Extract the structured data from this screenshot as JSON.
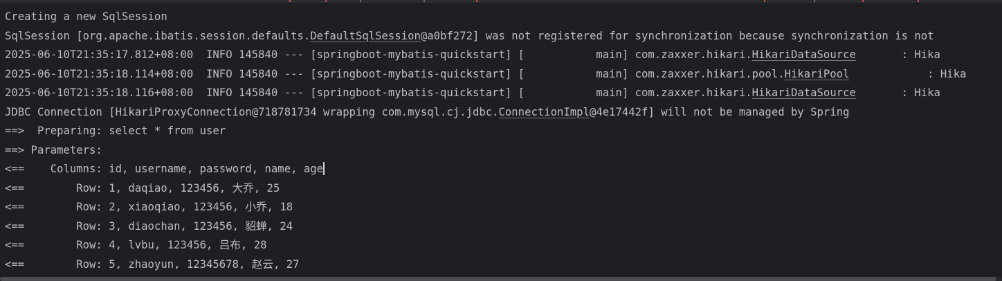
{
  "console": {
    "line0": "Creating a new SqlSession",
    "line1": {
      "a": "SqlSession [org.apache.ibatis.session.defaults.",
      "link": "DefaultSqlSession",
      "b": "@a0bf272] was not registered for synchronization because synchronization is not"
    },
    "line2": {
      "a": "2025-06-10T21:35:17.812+08:00  INFO 145840 --- [springboot-mybatis-quickstart] [           main] com.zaxxer.hikari.",
      "link": "HikariDataSource",
      "b": "       : Hika"
    },
    "line3": {
      "a": "2025-06-10T21:35:18.114+08:00  INFO 145840 --- [springboot-mybatis-quickstart] [           main] com.zaxxer.hikari.pool.",
      "link": "HikariPool",
      "b": "            : Hika"
    },
    "line4": {
      "a": "2025-06-10T21:35:18.116+08:00  INFO 145840 --- [springboot-mybatis-quickstart] [           main] com.zaxxer.hikari.",
      "link": "HikariDataSource",
      "b": "       : Hika"
    },
    "line5": {
      "a": "JDBC Connection [HikariProxyConnection@718781734 wrapping com.mysql.cj.jdbc.",
      "link": "ConnectionImpl",
      "b": "@4e17442f] will not be managed by Spring"
    },
    "line6": "==>  Preparing: select * from user",
    "line7": "==> Parameters: ",
    "line8": "<==    Columns: id, username, password, name, age",
    "line9": "<==        Row: 1, daqiao, 123456, 大乔, 25",
    "line10": "<==        Row: 2, xiaoqiao, 123456, 小乔, 18",
    "line11": "<==        Row: 3, diaochan, 123456, 貂蝉, 24",
    "line12": "<==        Row: 4, lvbu, 123456, 吕布, 28",
    "line13": "<==        Row: 5, zhaoyun, 12345678, 赵云, 27"
  },
  "colors": {
    "background": "#1e1f22",
    "text": "#bcbec4",
    "top_strip_marks": "#c94f4f"
  }
}
